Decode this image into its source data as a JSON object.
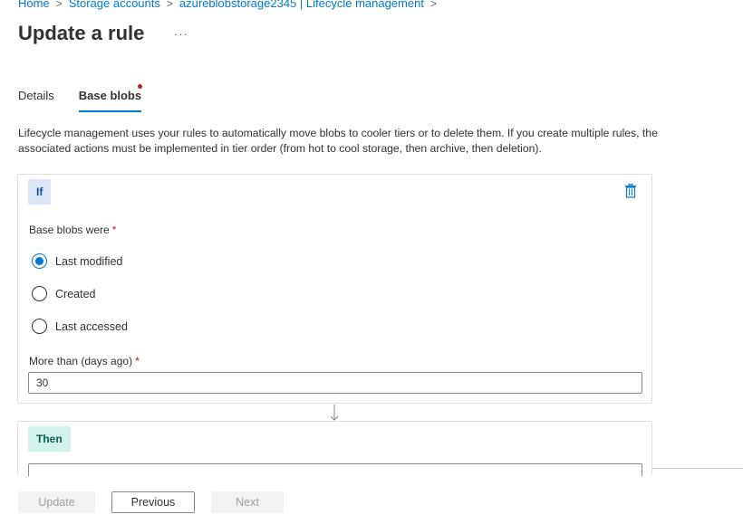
{
  "breadcrumb": {
    "items": [
      "Home",
      "Storage accounts",
      "azureblobstorage2345 | Lifecycle management"
    ],
    "separator": ">"
  },
  "page": {
    "title": "Update a rule",
    "more_label": "···"
  },
  "tabs": [
    {
      "label": "Details",
      "active": false
    },
    {
      "label": "Base blobs",
      "active": true,
      "has_error_dot": true
    }
  ],
  "description": "Lifecycle management uses your rules to automatically move blobs to cooler tiers or to delete them. If you create multiple rules, the associated actions must be implemented in tier order (from hot to cool storage, then archive, then deletion).",
  "if_block": {
    "badge": "If",
    "base_blobs_label": "Base blobs were",
    "required_marker": "*",
    "options": [
      {
        "label": "Last modified",
        "checked": true
      },
      {
        "label": "Created",
        "checked": false
      },
      {
        "label": "Last accessed",
        "checked": false
      }
    ],
    "days_label": "More than (days ago)",
    "days_value": "30"
  },
  "then_block": {
    "badge": "Then"
  },
  "footer": {
    "update_label": "Update",
    "previous_label": "Previous",
    "next_label": "Next"
  },
  "colors": {
    "accent": "#0078d4",
    "required": "#a4262c",
    "if_badge_bg": "#dde6f7",
    "then_badge_bg": "#d2f2ec"
  },
  "icons": [
    "chevron-right-icon",
    "more-icon",
    "delete-icon",
    "arrow-down-icon"
  ]
}
